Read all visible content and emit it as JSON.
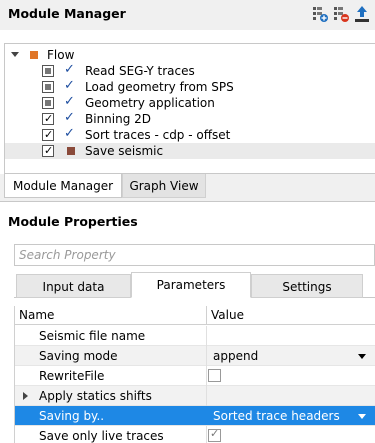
{
  "module_manager": {
    "title": "Module Manager",
    "icons": [
      "add-module-icon",
      "remove-module-icon",
      "upload-icon"
    ]
  },
  "tree": {
    "root_label": "Flow",
    "items": [
      {
        "label": "Read SEG-Y traces",
        "checkbox": "partial"
      },
      {
        "label": "Load geometry from SPS",
        "checkbox": "partial"
      },
      {
        "label": "Geometry application",
        "checkbox": "partial"
      },
      {
        "label": "Binning 2D",
        "checkbox": "checked"
      },
      {
        "label": "Sort traces - cdp - offset",
        "checkbox": "checked"
      },
      {
        "label": "Save seismic",
        "checkbox": "checked"
      }
    ]
  },
  "bottom_tabs": [
    "Module Manager",
    "Graph View"
  ],
  "module_properties": {
    "title": "Module Properties",
    "search_placeholder": "Search Property",
    "tabs": [
      "Input data",
      "Parameters",
      "Settings"
    ],
    "active_tab": "Parameters",
    "columns": [
      "Name",
      "Value"
    ],
    "rows": [
      {
        "name": "Seismic file name",
        "value": ""
      },
      {
        "name": "Saving mode",
        "value": "append"
      },
      {
        "name": "RewriteFile",
        "value": ""
      },
      {
        "name": "Apply statics shifts",
        "value": ""
      },
      {
        "name": "Saving by..",
        "value": "Sorted trace headers"
      },
      {
        "name": "Save only live traces",
        "value": ""
      }
    ]
  },
  "colors": {
    "flow_icon": "#e07628",
    "selection": "#1e88e5",
    "check_blue": "#1f4fa0"
  }
}
